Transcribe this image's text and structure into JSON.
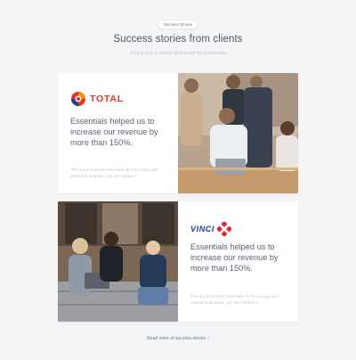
{
  "section": {
    "badge": "Success Stories",
    "title": "Success stories from clients",
    "subtitle": "This is just a simple text made for Essentials"
  },
  "stories": [
    {
      "logo_text": "TOTAL",
      "headline": "Essentials helped us to increase our revenue by more than 150%.",
      "body": "This is just a simple text made for this unique and awesome template, you can replace it."
    },
    {
      "logo_text": "VINCI",
      "headline": "Essentials helped us to increase our revenue by more than 150%.",
      "body": "This is just a simple text made for this unique and awesome template, you can replace it."
    }
  ],
  "read_more": {
    "label": "Read more of success stories",
    "arrow": "›"
  },
  "colors": {
    "background": "#f4f5f7",
    "total_red": "#e4342a",
    "total_orange": "#f39200",
    "vinci_blue": "#1d3f8f",
    "vinci_red": "#e2262b"
  }
}
